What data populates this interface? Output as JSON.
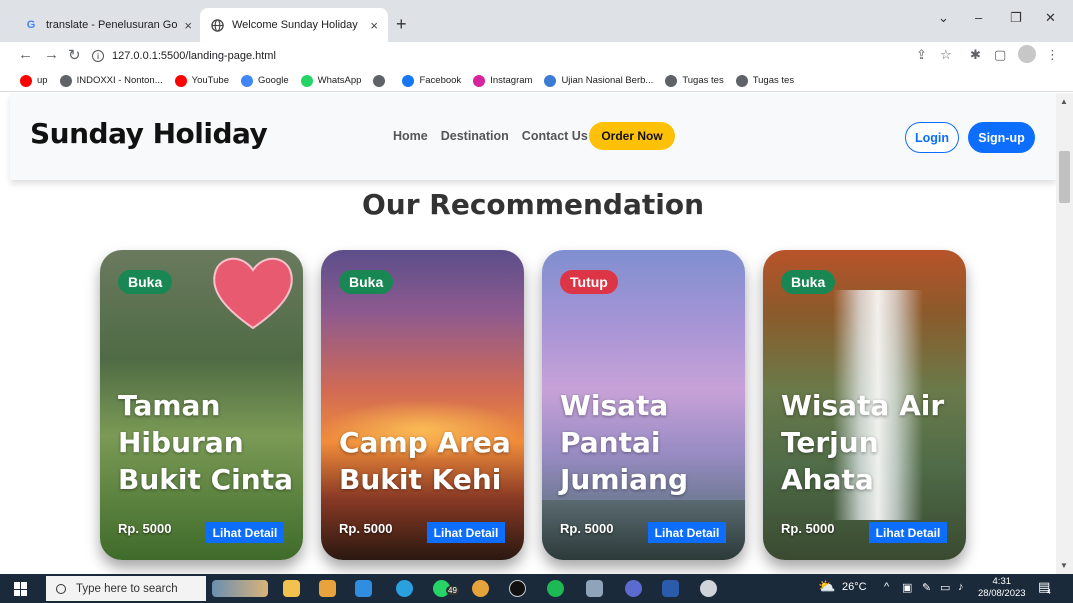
{
  "browser": {
    "tabs": [
      {
        "favicon": "G",
        "title": "translate - Penelusuran Google",
        "close": "×"
      },
      {
        "favicon": "globe",
        "title": "Welcome Sunday Holiday",
        "close": "×"
      }
    ],
    "new_tab": "+",
    "window_controls": [
      "⌄",
      "–",
      "❐",
      "✕"
    ],
    "url": "127.0.0.1:5500/landing-page.html",
    "bookmarks": [
      {
        "label": "up",
        "icon": "youtube-icon",
        "color": "#ff0000"
      },
      {
        "label": "INDOXXI - Nonton...",
        "icon": "globe-icon",
        "color": "#5f6368"
      },
      {
        "label": "YouTube",
        "icon": "youtube-icon",
        "color": "#ff0000"
      },
      {
        "label": "Google",
        "icon": "google-icon",
        "color": "#4285f4"
      },
      {
        "label": "WhatsApp",
        "icon": "whatsapp-icon",
        "color": "#25d366"
      },
      {
        "label": "",
        "icon": "globe-icon",
        "color": "#5f6368"
      },
      {
        "label": "Facebook",
        "icon": "facebook-icon",
        "color": "#1877f2"
      },
      {
        "label": "Instagram",
        "icon": "instagram-icon",
        "color": "#d6249f"
      },
      {
        "label": "Ujian Nasional Berb...",
        "icon": "globe-icon",
        "color": "#3b7bd4"
      },
      {
        "label": "Tugas tes",
        "icon": "globe-icon",
        "color": "#5f6368"
      },
      {
        "label": "Tugas tes",
        "icon": "globe-icon",
        "color": "#5f6368"
      }
    ]
  },
  "site": {
    "brand": "Sunday Holiday",
    "nav": [
      "Home",
      "Destination",
      "Contact Us"
    ],
    "order_button": "Order Now",
    "login_button": "Login",
    "signup_button": "Sign-up",
    "section_title": "Our Recommendation",
    "cards": [
      {
        "status": "Buka",
        "name": "Taman Hiburan Bukit Cinta",
        "price": "Rp. 5000",
        "detail": "Lihat Detail"
      },
      {
        "status": "Buka",
        "name": "Camp Area Bukit Kehi",
        "price": "Rp. 5000",
        "detail": "Lihat Detail"
      },
      {
        "status": "Tutup",
        "name": "Wisata Pantai Jumiang",
        "price": "Rp. 5000",
        "detail": "Lihat Detail"
      },
      {
        "status": "Buka",
        "name": "Wisata Air Terjun Ahata",
        "price": "Rp. 5000",
        "detail": "Lihat Detail"
      }
    ]
  },
  "taskbar": {
    "search_placeholder": "Type here to search",
    "weather": "26°C",
    "time": "4:31",
    "date": "28/08/2023",
    "whatsapp_badge": "49",
    "notifications": "4"
  },
  "colors": {
    "primary": "#0d6efd",
    "warning": "#ffc107",
    "open": "#198754",
    "closed": "#dc3545"
  }
}
